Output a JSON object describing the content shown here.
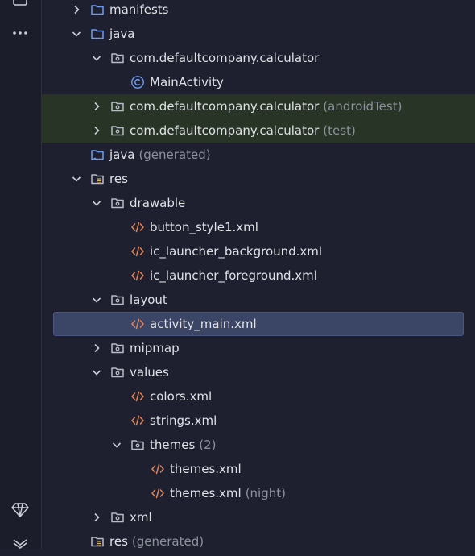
{
  "sidebar": {
    "icons": [
      "folder-icon",
      "more-icon",
      "diamond-icon",
      "vcs-icon"
    ]
  },
  "tree": {
    "manifests": "manifests",
    "java": "java",
    "pkg_main": "com.defaultcompany.calculator",
    "main_activity": "MainActivity",
    "pkg_android_test": "com.defaultcompany.calculator",
    "pkg_android_test_suffix": "(androidTest)",
    "pkg_test": "com.defaultcompany.calculator",
    "pkg_test_suffix": "(test)",
    "java_generated": "java",
    "java_generated_suffix": "(generated)",
    "res": "res",
    "drawable": "drawable",
    "button_style1": "button_style1.xml",
    "ic_launcher_background": "ic_launcher_background.xml",
    "ic_launcher_foreground": "ic_launcher_foreground.xml",
    "layout": "layout",
    "activity_main": "activity_main.xml",
    "mipmap": "mipmap",
    "values": "values",
    "colors": "colors.xml",
    "strings": "strings.xml",
    "themes_folder": "themes",
    "themes_folder_count": "(2)",
    "themes_xml": "themes.xml",
    "themes_xml_night": "themes.xml",
    "themes_xml_night_suffix": "(night)",
    "xml": "xml",
    "res_generated": "res",
    "res_generated_suffix": "(generated)"
  },
  "colors": {
    "background": "#1e2030",
    "selection": "#3b4566",
    "test_highlight": "#283526",
    "folder_blue": "#6f9cf0",
    "xml_orange": "#e0845a",
    "class_blue": "#6f9cf0"
  }
}
